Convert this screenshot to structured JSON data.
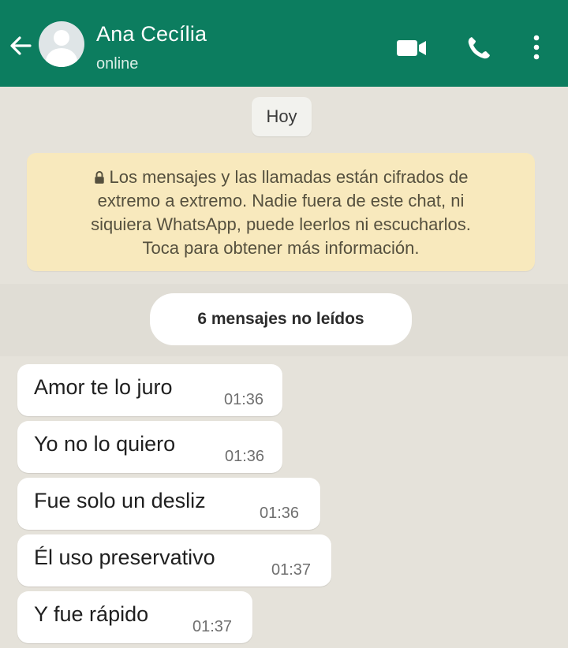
{
  "header": {
    "contact_name": "Ana Cecília",
    "status": "online",
    "icons": [
      "back-arrow-icon",
      "avatar-icon",
      "video-call-icon",
      "voice-call-icon",
      "more-options-icon"
    ],
    "background_color": "#0c7d5f"
  },
  "chat": {
    "date_label": "Hoy",
    "encryption_notice": {
      "icon": "lock-icon",
      "lines": [
        "Los mensajes y las llamadas están cifrados de",
        "extremo a extremo. Nadie fuera de este chat, ni",
        "siquiera WhatsApp, puede leerlos ni escucharlos.",
        "Toca para obtener más información."
      ]
    },
    "unread_label": "6 mensajes no leídos",
    "messages": [
      {
        "text": "Amor te lo juro",
        "time": "01:36"
      },
      {
        "text": "Yo no lo quiero",
        "time": "01:36"
      },
      {
        "text": "Fue solo un desliz",
        "time": "01:36"
      },
      {
        "text": "Él uso preservativo",
        "time": "01:37"
      },
      {
        "text": "Y fue rápido",
        "time": "01:37"
      }
    ]
  }
}
